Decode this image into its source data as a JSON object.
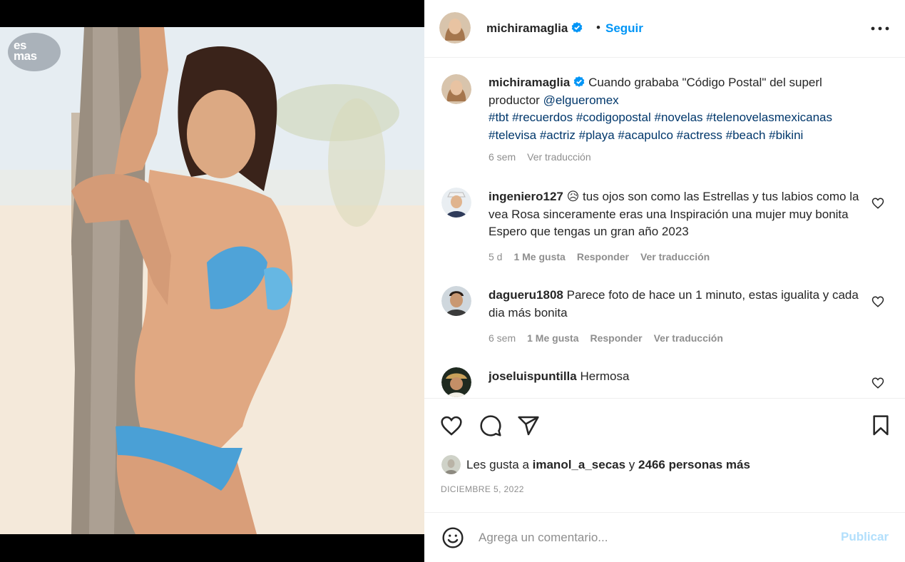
{
  "media": {
    "watermark_line1": "es",
    "watermark_line2": "mas"
  },
  "header": {
    "username": "michiramaglia",
    "separator": "•",
    "follow_label": "Seguir"
  },
  "caption": {
    "username": "michiramaglia",
    "text": "Cuando grababa \"Código Postal\" del superl productor",
    "mention": "@elgueromex",
    "hashtags": "#tbt #recuerdos #codigopostal #novelas #telenovelasmexicanas #televisa #actriz #playa #acapulco #actress #beach #bikini",
    "age": "6 sem",
    "translate": "Ver traducción"
  },
  "comments": [
    {
      "username": "ingeniero127",
      "text": "😥 tus ojos son como las Estrellas y tus labios como la vea Rosa sinceramente eras una Inspiración una mujer muy bonita Espero que tengas un gran año 2023",
      "age": "5 d",
      "likes": "1 Me gusta",
      "reply": "Responder",
      "translate": "Ver traducción"
    },
    {
      "username": "dagueru1808",
      "text": "Parece foto de hace un 1 minuto, estas igualita y cada dia más bonita",
      "age": "6 sem",
      "likes": "1 Me gusta",
      "reply": "Responder",
      "translate": "Ver traducción"
    },
    {
      "username": "joseluispuntilla",
      "text": "Hermosa"
    }
  ],
  "likes": {
    "prefix": "Les gusta a",
    "user": "imanol_a_secas",
    "conj": "y",
    "others": "2466 personas más"
  },
  "date": "DICIEMBRE 5, 2022",
  "add_comment": {
    "placeholder": "Agrega un comentario...",
    "publish_label": "Publicar"
  },
  "colors": {
    "accent": "#0095f6",
    "link": "#00376b",
    "muted": "#8e8e8e",
    "publish_disabled": "#b2dffc",
    "verified": "#0095f6"
  },
  "icons": [
    "more-options-icon",
    "verified-badge-icon",
    "heart-icon",
    "comment-icon",
    "share-icon",
    "bookmark-icon",
    "emoji-icon"
  ]
}
